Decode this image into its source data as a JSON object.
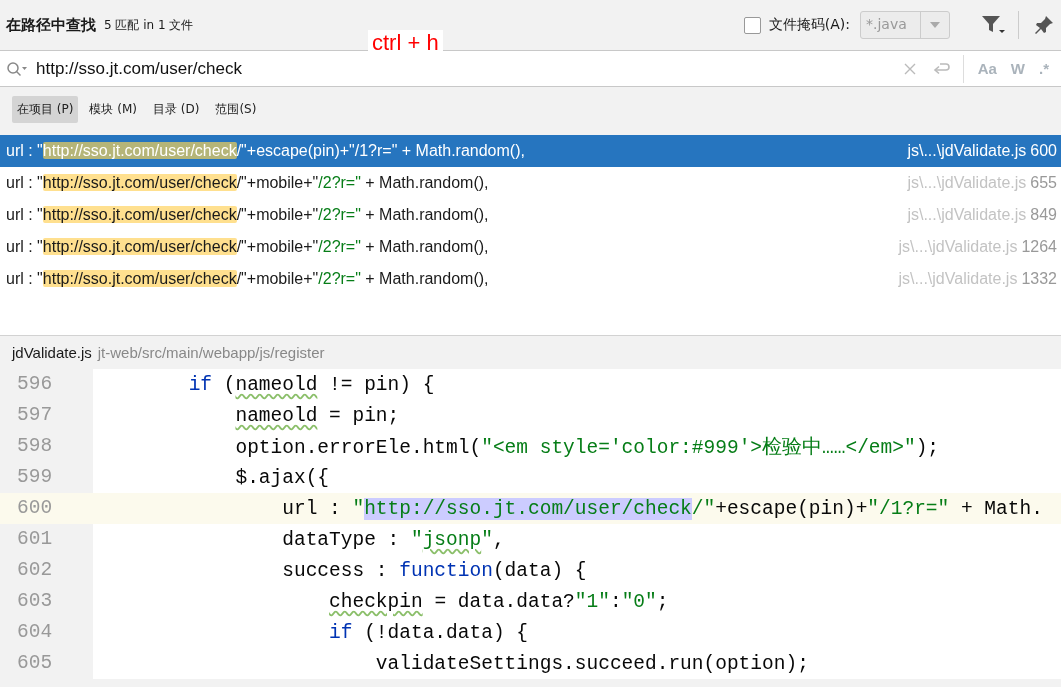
{
  "header": {
    "title": "在路径中查找",
    "count": "5 匹配 in 1 文件",
    "file_mask": {
      "label": "文件掩码(A):",
      "checked": false,
      "value": "*.java",
      "disabled": true
    }
  },
  "annotation": "ctrl + h",
  "search": {
    "value": "http://sso.jt.com/user/check",
    "toggles": [
      {
        "label": "Aa",
        "selected": false
      },
      {
        "label": "W",
        "selected": false
      },
      {
        "label": ".*",
        "selected": false
      }
    ]
  },
  "scopes": [
    {
      "label": "在项目 (P)",
      "selected": true
    },
    {
      "label": "模块 (M)",
      "selected": false
    },
    {
      "label": "目录 (D)",
      "selected": false
    },
    {
      "label": "范围(S)",
      "selected": false
    }
  ],
  "results": [
    {
      "selected": true,
      "segments": [
        {
          "t": "url : \"",
          "kind": "plain"
        },
        {
          "t": "http://sso.jt.com/user/check",
          "kind": "match"
        },
        {
          "t": "/\"+escape(pin)+\"/1?r=\" + Math.random(),",
          "kind": "plain"
        }
      ],
      "file": "js\\...\\jdValidate.js",
      "line": "600"
    },
    {
      "selected": false,
      "segments": [
        {
          "t": "url : \"",
          "kind": "plain"
        },
        {
          "t": "http://sso.jt.com/user/check",
          "kind": "match"
        },
        {
          "t": "/\"+mobile+\"",
          "kind": "plain"
        },
        {
          "t": "/2?r=\"",
          "kind": "str"
        },
        {
          "t": " + Math.random(),",
          "kind": "plain"
        }
      ],
      "file": "js\\...\\jdValidate.js",
      "line": "655"
    },
    {
      "selected": false,
      "segments": [
        {
          "t": "url : \"",
          "kind": "plain"
        },
        {
          "t": "http://sso.jt.com/user/check",
          "kind": "match"
        },
        {
          "t": "/\"+mobile+\"",
          "kind": "plain"
        },
        {
          "t": "/2?r=\"",
          "kind": "str"
        },
        {
          "t": " + Math.random(),",
          "kind": "plain"
        }
      ],
      "file": "js\\...\\jdValidate.js",
      "line": "849"
    },
    {
      "selected": false,
      "segments": [
        {
          "t": "url : \"",
          "kind": "plain"
        },
        {
          "t": "http://sso.jt.com/user/check",
          "kind": "match"
        },
        {
          "t": "/\"+mobile+\"",
          "kind": "plain"
        },
        {
          "t": "/2?r=\"",
          "kind": "str"
        },
        {
          "t": " + Math.random(),",
          "kind": "plain"
        }
      ],
      "file": "js\\...\\jdValidate.js",
      "line": "1264"
    },
    {
      "selected": false,
      "segments": [
        {
          "t": "url : \"",
          "kind": "plain"
        },
        {
          "t": "http://sso.jt.com/user/check",
          "kind": "match"
        },
        {
          "t": "/\"+mobile+\"",
          "kind": "plain"
        },
        {
          "t": "/2?r=\"",
          "kind": "str"
        },
        {
          "t": " + Math.random(),",
          "kind": "plain"
        }
      ],
      "file": "js\\...\\jdValidate.js",
      "line": "1332"
    }
  ],
  "preview": {
    "file": "jdValidate.js",
    "path": "jt-web/src/main/webapp/js/register",
    "lines": [
      {
        "n": "596",
        "current": false,
        "segments": [
          {
            "t": "        if",
            "kind": "kw"
          },
          {
            "t": " (",
            "kind": "plain"
          },
          {
            "t": "nameold",
            "kind": "typo"
          },
          {
            "t": " != pin) {",
            "kind": "plain"
          }
        ]
      },
      {
        "n": "597",
        "current": false,
        "segments": [
          {
            "t": "            nameold",
            "kind": "typo"
          },
          {
            "t": " = pin;",
            "kind": "plain"
          }
        ]
      },
      {
        "n": "598",
        "current": false,
        "segments": [
          {
            "t": "            option.errorEle.html(",
            "kind": "plain"
          },
          {
            "t": "\"<em style='color:#999'>检验中……</em>\"",
            "kind": "str"
          },
          {
            "t": ");",
            "kind": "plain"
          }
        ]
      },
      {
        "n": "599",
        "current": false,
        "segments": [
          {
            "t": "            $.ajax({",
            "kind": "plain"
          }
        ]
      },
      {
        "n": "600",
        "current": true,
        "segments": [
          {
            "t": "                url : ",
            "kind": "plain"
          },
          {
            "t": "\"",
            "kind": "str"
          },
          {
            "t": "http://sso.jt.com/user/check",
            "kind": "match"
          },
          {
            "t": "/\"",
            "kind": "str"
          },
          {
            "t": "+escape(pin)+",
            "kind": "plain"
          },
          {
            "t": "\"/1?r=\"",
            "kind": "str"
          },
          {
            "t": " + Math.",
            "kind": "plain"
          }
        ]
      },
      {
        "n": "601",
        "current": false,
        "segments": [
          {
            "t": "                dataType : ",
            "kind": "plain"
          },
          {
            "t": "\"",
            "kind": "str"
          },
          {
            "t": "jsonp",
            "kind": "strtypo"
          },
          {
            "t": "\"",
            "kind": "str"
          },
          {
            "t": ",",
            "kind": "plain"
          }
        ]
      },
      {
        "n": "602",
        "current": false,
        "segments": [
          {
            "t": "                success : ",
            "kind": "plain"
          },
          {
            "t": "function",
            "kind": "kw"
          },
          {
            "t": "(data) {",
            "kind": "plain"
          }
        ]
      },
      {
        "n": "603",
        "current": false,
        "segments": [
          {
            "t": "                    checkpin",
            "kind": "typo"
          },
          {
            "t": " = data.data?",
            "kind": "plain"
          },
          {
            "t": "\"1\"",
            "kind": "str"
          },
          {
            "t": ":",
            "kind": "plain"
          },
          {
            "t": "\"0\"",
            "kind": "str"
          },
          {
            "t": ";",
            "kind": "plain"
          }
        ]
      },
      {
        "n": "604",
        "current": false,
        "segments": [
          {
            "t": "                    if",
            "kind": "kw"
          },
          {
            "t": " (!data.data) {",
            "kind": "plain"
          }
        ]
      },
      {
        "n": "605",
        "current": false,
        "segments": [
          {
            "t": "                        validateSettings.succeed.run(option);",
            "kind": "plain"
          }
        ]
      }
    ]
  }
}
